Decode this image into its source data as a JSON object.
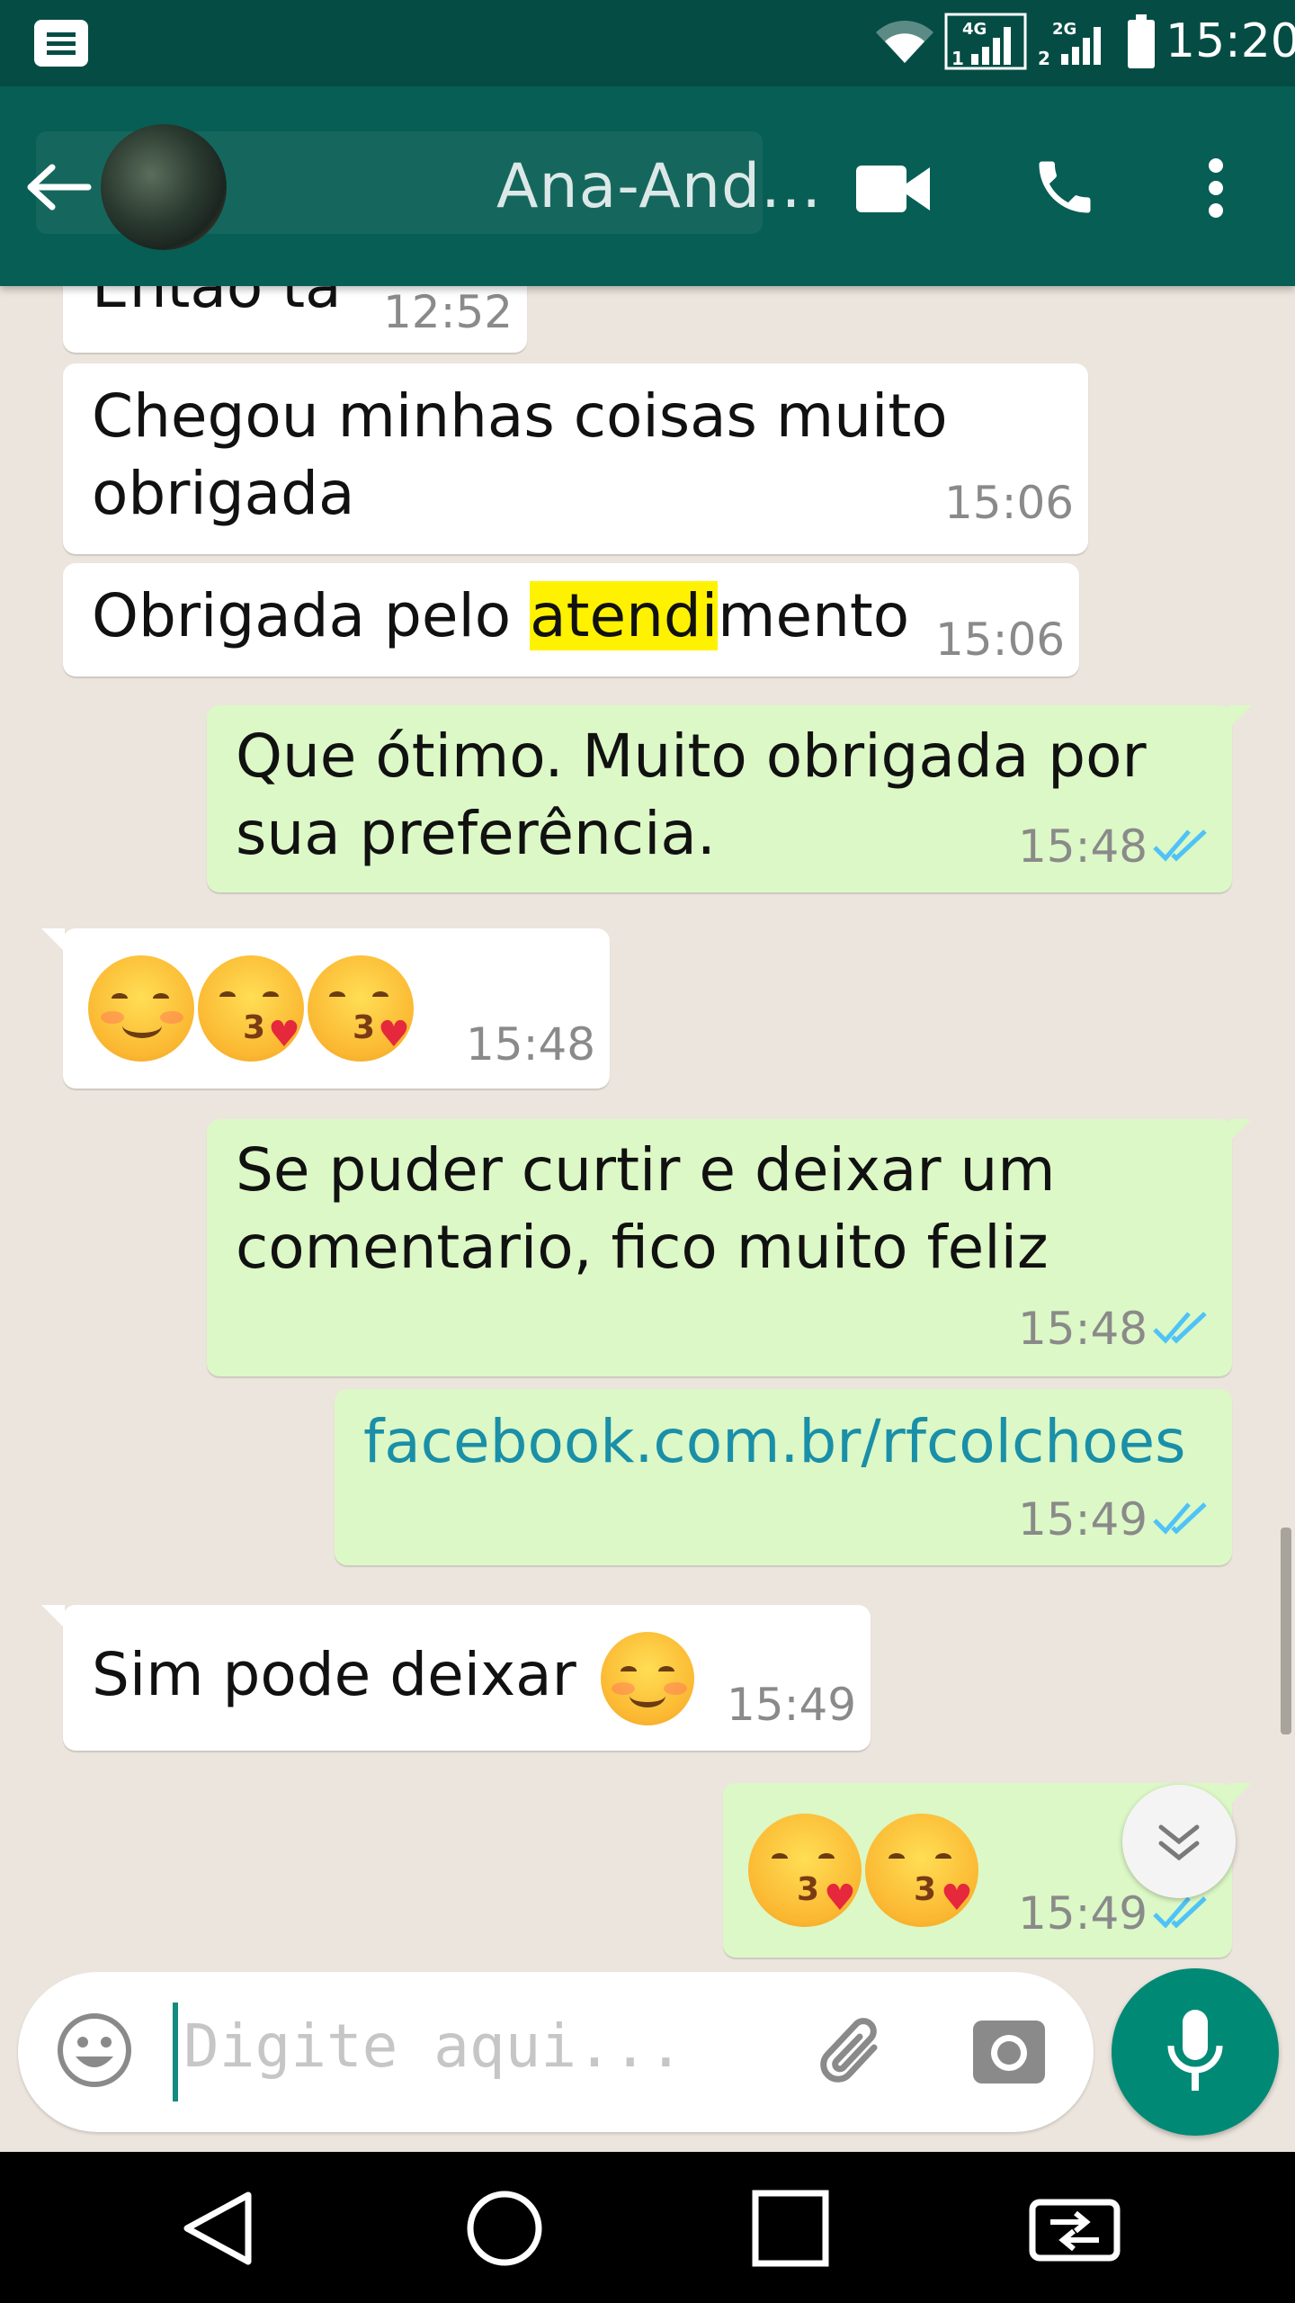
{
  "status_bar": {
    "time": "15:20",
    "network_1": "4G",
    "network_2": "2G",
    "sim_1": "1",
    "sim_2": "2"
  },
  "header": {
    "back_icon": "arrow-left-icon",
    "contact_name": "Ana-And...",
    "actions": [
      "video-call-icon",
      "phone-icon",
      "more-vert-icon"
    ]
  },
  "messages": [
    {
      "dir": "in",
      "text": "Então tá",
      "time": "12:52"
    },
    {
      "dir": "in",
      "text": "Chegou minhas coisas muito obrigada",
      "line1": "Chegou minhas coisas muito",
      "line2": "obrigada",
      "time": "15:06"
    },
    {
      "dir": "in",
      "text_before": "Obrigada pelo ",
      "text_highlight": "atendi",
      "text_after": "mento",
      "time": "15:06"
    },
    {
      "dir": "out",
      "line1": "Que ótimo. Muito obrigada por",
      "line2": "sua preferência.",
      "time": "15:48",
      "status": "read"
    },
    {
      "dir": "in",
      "emojis": [
        "smirk",
        "kiss-heart",
        "kiss-heart"
      ],
      "time": "15:48"
    },
    {
      "dir": "out",
      "line1": "Se puder curtir e deixar um",
      "line2": "comentario, fico muito feliz",
      "time": "15:48",
      "status": "read"
    },
    {
      "dir": "out",
      "link": "facebook.com.br/rfcolchoes",
      "time": "15:49",
      "status": "read"
    },
    {
      "dir": "in",
      "text": "Sim pode deixar",
      "emojis": [
        "smirk"
      ],
      "time": "15:49"
    },
    {
      "dir": "out",
      "emojis": [
        "kiss-heart",
        "kiss-heart"
      ],
      "time": "15:49",
      "status": "read"
    }
  ],
  "composer": {
    "placeholder": "Digite aqui...",
    "emoji_icon": "smiley-icon",
    "attach_icon": "paperclip-icon",
    "camera_icon": "camera-icon",
    "mic_icon": "microphone-icon"
  },
  "nav": [
    "back-triangle-icon",
    "home-circle-icon",
    "recents-square-icon",
    "sim-switch-icon"
  ],
  "colors": {
    "status_bar": "#054d44",
    "app_bar": "#075e54",
    "chat_bg": "#ece5dd",
    "incoming": "#ffffff",
    "outgoing": "#dcf8c6",
    "accent": "#008a76",
    "link": "#1a8fa8",
    "read_ticks": "#4fc3f7",
    "highlight": "#fff200"
  }
}
